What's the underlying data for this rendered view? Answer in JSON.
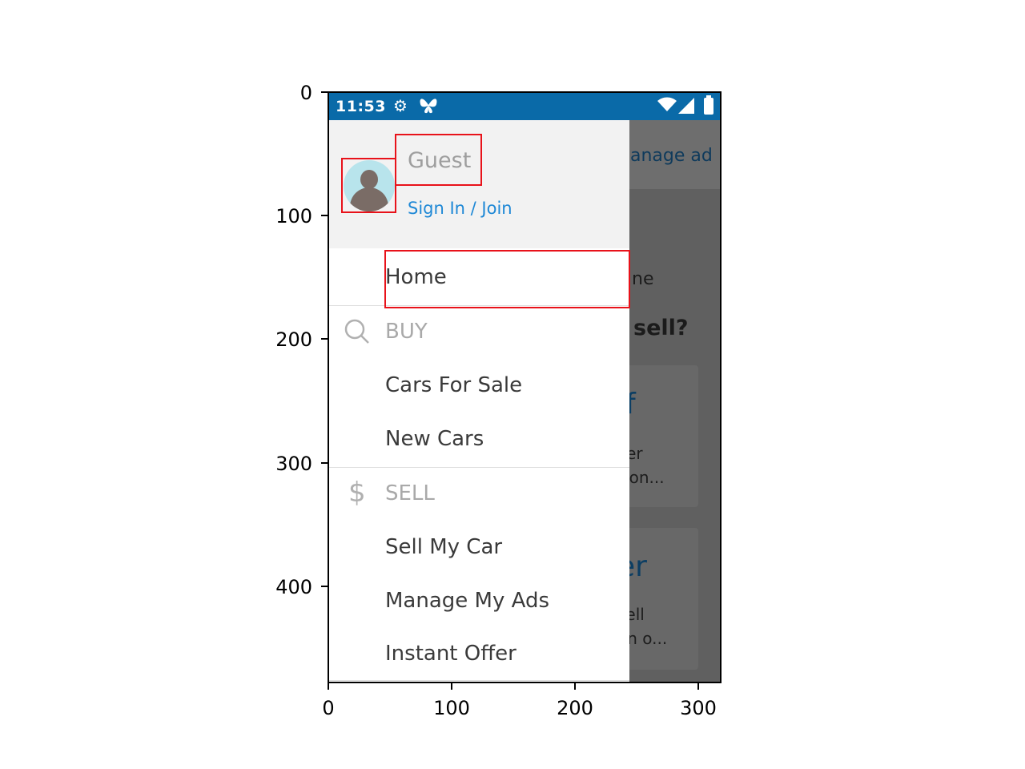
{
  "axes": {
    "y_ticks": [
      "0",
      "100",
      "200",
      "300",
      "400"
    ],
    "x_ticks": [
      "0",
      "100",
      "200",
      "300"
    ]
  },
  "status_bar": {
    "time": "11:53",
    "icons": [
      "gear-icon",
      "butterfly-icon",
      "wifi-icon",
      "signal-icon",
      "battery-icon"
    ]
  },
  "background_app": {
    "header_text": "anage ad",
    "fragments": {
      "home_fragment": "ne",
      "question_fragment": "sell?",
      "card1_big": "lf",
      "card1_line1": "ller",
      "card1_line2": "r on...",
      "card2_big": "er",
      "card2_line1": "sell",
      "card2_line2": "an o..."
    }
  },
  "drawer": {
    "user_name": "Guest",
    "sign_in_label": "Sign In / Join",
    "home_label": "Home",
    "buy_section": {
      "label": "BUY",
      "icon": "search-icon",
      "items": [
        "Cars For Sale",
        "New Cars"
      ]
    },
    "sell_section": {
      "label": "SELL",
      "icon": "dollar-icon",
      "items": [
        "Sell My Car",
        "Manage My Ads",
        "Instant Offer"
      ]
    }
  },
  "colors": {
    "status_bar": "#0a6aa8",
    "drawer_header": "#f2f2f2",
    "link": "#1e88d6",
    "annotation": "#e8121a"
  }
}
